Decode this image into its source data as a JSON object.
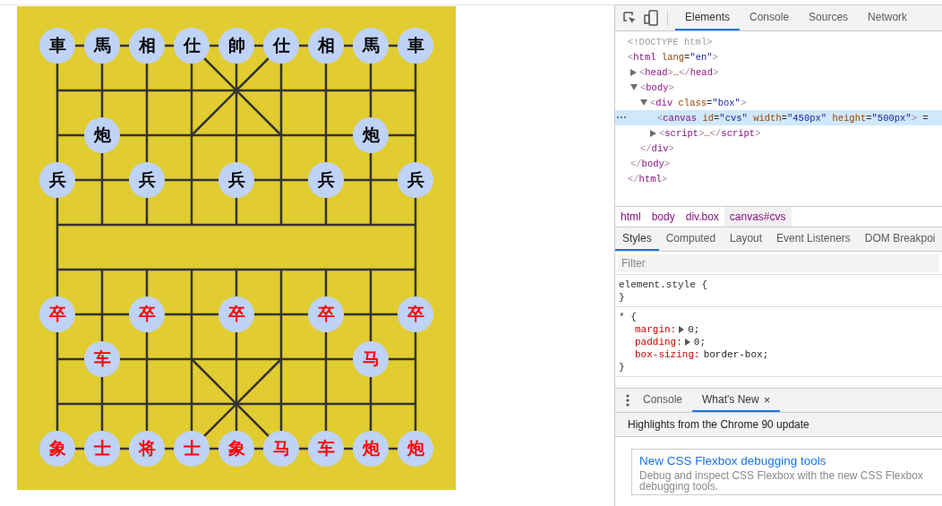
{
  "board": {
    "ranks": [
      {
        "points": [
          {
            "kind": "piece",
            "label": "車",
            "color": "#000000"
          },
          {
            "kind": "piece",
            "label": "馬",
            "color": "#000000"
          },
          {
            "kind": "piece",
            "label": "相",
            "color": "#000000"
          },
          {
            "kind": "piece",
            "label": "仕",
            "color": "#000000"
          },
          {
            "kind": "piece",
            "label": "帥",
            "color": "#000000"
          },
          {
            "kind": "piece",
            "label": "仕",
            "color": "#000000"
          },
          {
            "kind": "piece",
            "label": "相",
            "color": "#000000"
          },
          {
            "kind": "piece",
            "label": "馬",
            "color": "#000000"
          },
          {
            "kind": "piece",
            "label": "車",
            "color": "#000000"
          }
        ]
      },
      {
        "points": [
          {
            "kind": "empty"
          },
          {
            "kind": "empty"
          },
          {
            "kind": "empty"
          },
          {
            "kind": "empty"
          },
          {
            "kind": "empty"
          },
          {
            "kind": "empty"
          },
          {
            "kind": "empty"
          },
          {
            "kind": "empty"
          },
          {
            "kind": "empty"
          }
        ]
      },
      {
        "points": [
          {
            "kind": "empty"
          },
          {
            "kind": "piece",
            "label": "炮",
            "color": "#000000"
          },
          {
            "kind": "empty"
          },
          {
            "kind": "empty"
          },
          {
            "kind": "empty"
          },
          {
            "kind": "empty"
          },
          {
            "kind": "empty"
          },
          {
            "kind": "piece",
            "label": "炮",
            "color": "#000000"
          },
          {
            "kind": "empty"
          }
        ]
      },
      {
        "points": [
          {
            "kind": "piece",
            "label": "兵",
            "color": "#000000"
          },
          {
            "kind": "empty"
          },
          {
            "kind": "piece",
            "label": "兵",
            "color": "#000000"
          },
          {
            "kind": "empty"
          },
          {
            "kind": "piece",
            "label": "兵",
            "color": "#000000"
          },
          {
            "kind": "empty"
          },
          {
            "kind": "piece",
            "label": "兵",
            "color": "#000000"
          },
          {
            "kind": "empty"
          },
          {
            "kind": "piece",
            "label": "兵",
            "color": "#000000"
          }
        ]
      },
      {
        "points": [
          {
            "kind": "empty"
          },
          {
            "kind": "empty"
          },
          {
            "kind": "empty"
          },
          {
            "kind": "empty"
          },
          {
            "kind": "empty"
          },
          {
            "kind": "empty"
          },
          {
            "kind": "empty"
          },
          {
            "kind": "empty"
          },
          {
            "kind": "empty"
          }
        ]
      },
      {
        "points": [
          {
            "kind": "empty"
          },
          {
            "kind": "empty"
          },
          {
            "kind": "empty"
          },
          {
            "kind": "empty"
          },
          {
            "kind": "empty"
          },
          {
            "kind": "empty"
          },
          {
            "kind": "empty"
          },
          {
            "kind": "empty"
          },
          {
            "kind": "empty"
          }
        ]
      },
      {
        "points": [
          {
            "kind": "piece",
            "label": "卒",
            "color": "#ff0000"
          },
          {
            "kind": "empty"
          },
          {
            "kind": "piece",
            "label": "卒",
            "color": "#ff0000"
          },
          {
            "kind": "empty"
          },
          {
            "kind": "piece",
            "label": "卒",
            "color": "#ff0000"
          },
          {
            "kind": "empty"
          },
          {
            "kind": "piece",
            "label": "卒",
            "color": "#ff0000"
          },
          {
            "kind": "empty"
          },
          {
            "kind": "piece",
            "label": "卒",
            "color": "#ff0000"
          }
        ]
      },
      {
        "points": [
          {
            "kind": "empty"
          },
          {
            "kind": "piece",
            "label": "车",
            "color": "#ff0000"
          },
          {
            "kind": "empty"
          },
          {
            "kind": "empty"
          },
          {
            "kind": "empty"
          },
          {
            "kind": "empty"
          },
          {
            "kind": "empty"
          },
          {
            "kind": "piece",
            "label": "马",
            "color": "#ff0000"
          },
          {
            "kind": "empty"
          }
        ]
      },
      {
        "points": [
          {
            "kind": "empty"
          },
          {
            "kind": "empty"
          },
          {
            "kind": "empty"
          },
          {
            "kind": "empty"
          },
          {
            "kind": "empty"
          },
          {
            "kind": "empty"
          },
          {
            "kind": "empty"
          },
          {
            "kind": "empty"
          },
          {
            "kind": "empty"
          }
        ]
      },
      {
        "points": [
          {
            "kind": "piece",
            "label": "象",
            "color": "#ff0000"
          },
          {
            "kind": "piece",
            "label": "士",
            "color": "#ff0000"
          },
          {
            "kind": "piece",
            "label": "将",
            "color": "#ff0000"
          },
          {
            "kind": "piece",
            "label": "士",
            "color": "#ff0000"
          },
          {
            "kind": "piece",
            "label": "象",
            "color": "#ff0000"
          },
          {
            "kind": "piece",
            "label": "马",
            "color": "#ff0000"
          },
          {
            "kind": "piece",
            "label": "车",
            "color": "#ff0000"
          },
          {
            "kind": "piece",
            "label": "炮",
            "color": "#ff0000"
          },
          {
            "kind": "piece",
            "label": "炮",
            "color": "#ff0000"
          }
        ]
      }
    ]
  },
  "devtools": {
    "tabs": [
      {
        "label": "Elements",
        "selected": true
      },
      {
        "label": "Console",
        "selected": false
      },
      {
        "label": "Sources",
        "selected": false
      },
      {
        "label": "Network",
        "selected": false
      }
    ],
    "dom_tree": [
      {
        "kind": "doctype",
        "text": "<!DOCTYPE html>",
        "selected": false
      },
      {
        "kind": "element",
        "text": "<html lang=\"en\">",
        "selected": false,
        "closing": "</html>",
        "children": [
          {
            "kind": "element",
            "text": "<head>…</head>",
            "selected": false,
            "expanded": false
          },
          {
            "kind": "element",
            "text": "<body>",
            "selected": false,
            "expanded": true,
            "closing": "</body>",
            "children": [
              {
                "kind": "element",
                "text": "<div class=\"box\">",
                "selected": false,
                "expanded": true,
                "closing": "</div>",
                "children": [
                  {
                    "kind": "element",
                    "text": "<canvas id=\"cvs\" width=\"450px\" height=\"500px\"> =",
                    "selected": true
                  },
                  {
                    "kind": "element",
                    "text": "<script>…</script>",
                    "selected": false,
                    "expanded": false
                  }
                ]
              }
            ]
          }
        ]
      }
    ],
    "breadcrumbs": [
      {
        "label": "html",
        "selected": false
      },
      {
        "label": "body",
        "selected": false
      },
      {
        "label": "div.box",
        "selected": false
      },
      {
        "label": "canvas#cvs",
        "selected": true
      }
    ],
    "style_tabs": [
      {
        "label": "Styles",
        "selected": true
      },
      {
        "label": "Computed",
        "selected": false
      },
      {
        "label": "Layout",
        "selected": false
      },
      {
        "label": "Event Listeners",
        "selected": false
      },
      {
        "label": "DOM Breakpoi",
        "selected": false
      }
    ],
    "filter": {
      "placeholder": "Filter"
    },
    "rules": [
      {
        "selector": "element.style {",
        "close": "}"
      },
      {
        "selector": "* {",
        "close": "}",
        "declarations": [
          {
            "property": "margin:",
            "value": "0;",
            "expandable": true
          },
          {
            "property": "padding:",
            "value": "0;",
            "expandable": true
          },
          {
            "property": "box-sizing:",
            "value": "border-box;"
          }
        ]
      }
    ],
    "drawer": {
      "tabs": [
        {
          "label": "Console",
          "selected": false
        },
        {
          "label": "What's New",
          "selected": true,
          "close": "×"
        }
      ],
      "headline": "Highlights from the Chrome 90 update",
      "card": {
        "title": "New CSS Flexbox debugging tools",
        "text": "Debug and inspect CSS Flexbox with the new CSS Flexbox debugging tools."
      }
    }
  }
}
